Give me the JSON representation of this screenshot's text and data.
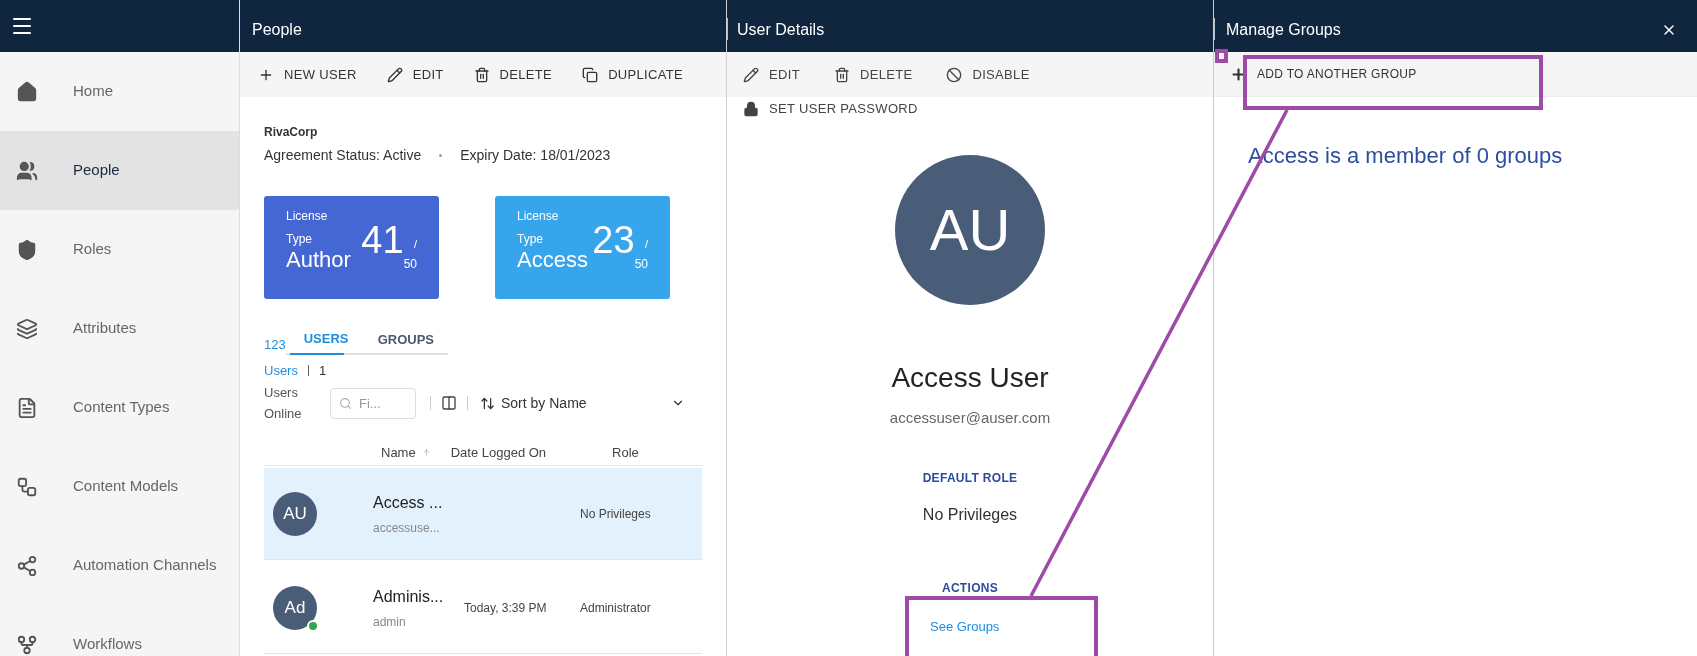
{
  "sidebar": {
    "items": [
      {
        "label": "Home",
        "selected": false
      },
      {
        "label": "People",
        "selected": true
      },
      {
        "label": "Roles",
        "selected": false
      },
      {
        "label": "Attributes",
        "selected": false
      },
      {
        "label": "Content Types",
        "selected": false
      },
      {
        "label": "Content Models",
        "selected": false
      },
      {
        "label": "Automation Channels",
        "selected": false
      },
      {
        "label": "Workflows",
        "selected": false
      }
    ]
  },
  "people_panel": {
    "title": "People",
    "toolbar": [
      "NEW USER",
      "EDIT",
      "DELETE",
      "DUPLICATE"
    ],
    "org": "RivaCorp",
    "agreement_status": "Agreement Status: Active",
    "expiry": "Expiry Date: 18/01/2023",
    "licenses": [
      {
        "label_1": "License",
        "label_2": "Type",
        "type": "Author",
        "count": "41",
        "separator": "/",
        "total": "50",
        "color": "#4467d4"
      },
      {
        "label_1": "License",
        "label_2": "Type",
        "type": "Access",
        "count": "23",
        "separator": "/",
        "total": "50",
        "color": "#37a5ec"
      }
    ],
    "tabs": [
      {
        "label": "USERS",
        "selected": true
      },
      {
        "label": "GROUPS",
        "selected": false
      }
    ],
    "user_count": "123",
    "users_label": "Users",
    "online_count": "1",
    "online_label": "Users Online",
    "filter": {
      "placeholder": "Fi..."
    },
    "sort": "Sort by Name",
    "columns": [
      "Name",
      "Date Logged On",
      "Role"
    ],
    "rows": [
      {
        "initials": "AU",
        "name": "Access ...",
        "email": "accessuse...",
        "date": "",
        "role": "No Privileges",
        "selected": true,
        "online": false
      },
      {
        "initials": "Ad",
        "name": "Adminis...",
        "email": "admin",
        "date": "Today, 3:39 PM",
        "role": "Administrator",
        "selected": false,
        "online": true
      }
    ]
  },
  "user_details": {
    "title": "User Details",
    "toolbar": [
      "EDIT",
      "DELETE",
      "DISABLE"
    ],
    "password_action": "SET USER PASSWORD",
    "initials": "AU",
    "name": "Access User",
    "email": "accessuser@auser.com",
    "default_role_label": "DEFAULT ROLE",
    "default_role": "No Privileges",
    "actions_label": "ACTIONS",
    "actions": [
      "See Groups"
    ]
  },
  "manage_groups": {
    "title": "Manage Groups",
    "toolbar": "ADD TO ANOTHER GROUP",
    "message": "Access is a member of 0 groups"
  }
}
